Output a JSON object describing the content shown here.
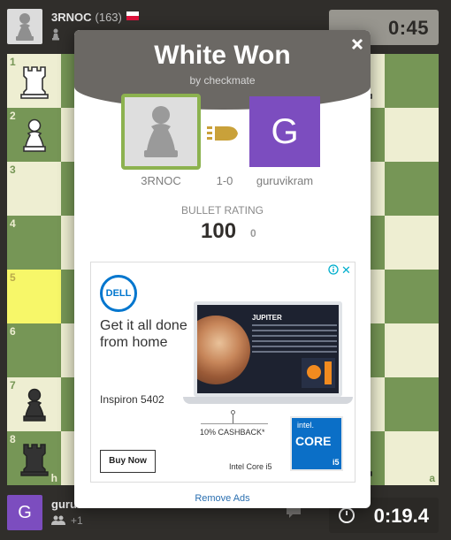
{
  "top_player": {
    "name": "3RNOC",
    "rating": "(163)",
    "clock": "0:45"
  },
  "bottom_player": {
    "name": "guru",
    "avatar_letter": "G",
    "sub_count": "+1",
    "clock": "0:19.4"
  },
  "board": {
    "ranks": [
      "1",
      "2",
      "3",
      "4",
      "5",
      "6",
      "7",
      "8"
    ],
    "files": [
      "h",
      "b",
      "a"
    ]
  },
  "modal": {
    "title": "White Won",
    "subtitle": "by checkmate",
    "white_player": "3RNOC",
    "black_player": "guruvikram",
    "black_avatar_letter": "G",
    "score": "1-0",
    "rating_label": "BULLET RATING",
    "rating_value": "100",
    "rating_delta": "0",
    "remove_ads": "Remove Ads"
  },
  "ad": {
    "brand": "DELL",
    "headline": "Get it all done from home",
    "model": "Inspiron 5402",
    "button": "Buy Now",
    "cashback": "10% CASHBACK*",
    "intel_caption": "Intel Core i5",
    "intel_badge": "intel.",
    "intel_core": "CORE",
    "intel_tier": "i5",
    "screen_title": "JUPITER"
  },
  "colors": {
    "board_light": "#eeeed2",
    "board_dark": "#769656",
    "highlight": "#f7f769",
    "win_border": "#8cb24f",
    "avatar_purple": "#7c4dbf"
  }
}
